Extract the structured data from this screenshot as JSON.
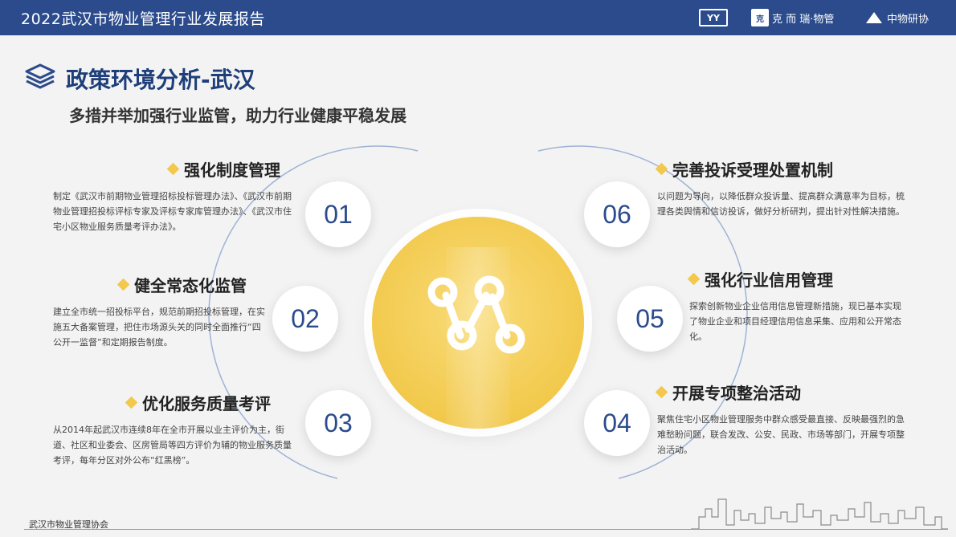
{
  "header": {
    "title": "2022武汉市物业管理行业发展报告",
    "logos": [
      {
        "text": "YY"
      },
      {
        "text": "克 而 瑞·物管"
      },
      {
        "text": "中物研协"
      }
    ]
  },
  "section": {
    "icon": "layers-icon",
    "title": "政策环境分析-武汉",
    "subtitle": "多措并举加强行业监管，助力行业健康平稳发展"
  },
  "items": [
    {
      "num": "01",
      "title": "强化制度管理",
      "body": "制定《武汉市前期物业管理招标投标管理办法》、《武汉市前期物业管理招投标评标专家及评标专家库管理办法》、《武汉市住宅小区物业服务质量考评办法》。"
    },
    {
      "num": "02",
      "title": "健全常态化监管",
      "body": "建立全市统一招投标平台，规范前期招投标管理，在实施五大备案管理，把住市场源头关的同时全面推行“四公开一监督”和定期报告制度。"
    },
    {
      "num": "03",
      "title": "优化服务质量考评",
      "body": "从2014年起武汉市连续8年在全市开展以业主评价为主，街道、社区和业委会、区房管局等四方评价为辅的物业服务质量考评，每年分区对外公布“红黑榜”。"
    },
    {
      "num": "04",
      "title": "开展专项整治活动",
      "body": "聚焦住宅小区物业管理服务中群众感受最直接、反映最强烈的急难愁盼问题，联合发改、公安、民政、市场等部门，开展专项整治活动。"
    },
    {
      "num": "05",
      "title": "强化行业信用管理",
      "body": "探索创新物业企业信用信息管理新措施，现已基本实现了物业企业和项目经理信用信息采集、应用和公开常态化。"
    },
    {
      "num": "06",
      "title": "完善投诉受理处置机制",
      "body": "以问题为导向，以降低群众投诉量、提高群众满意率为目标，梳理各类舆情和信访投诉，做好分析研判，提出针对性解决措施。"
    }
  ],
  "footer": {
    "org": "武汉市物业管理协会"
  },
  "colors": {
    "brand": "#2b4b8c",
    "accent": "#f2c94c"
  }
}
